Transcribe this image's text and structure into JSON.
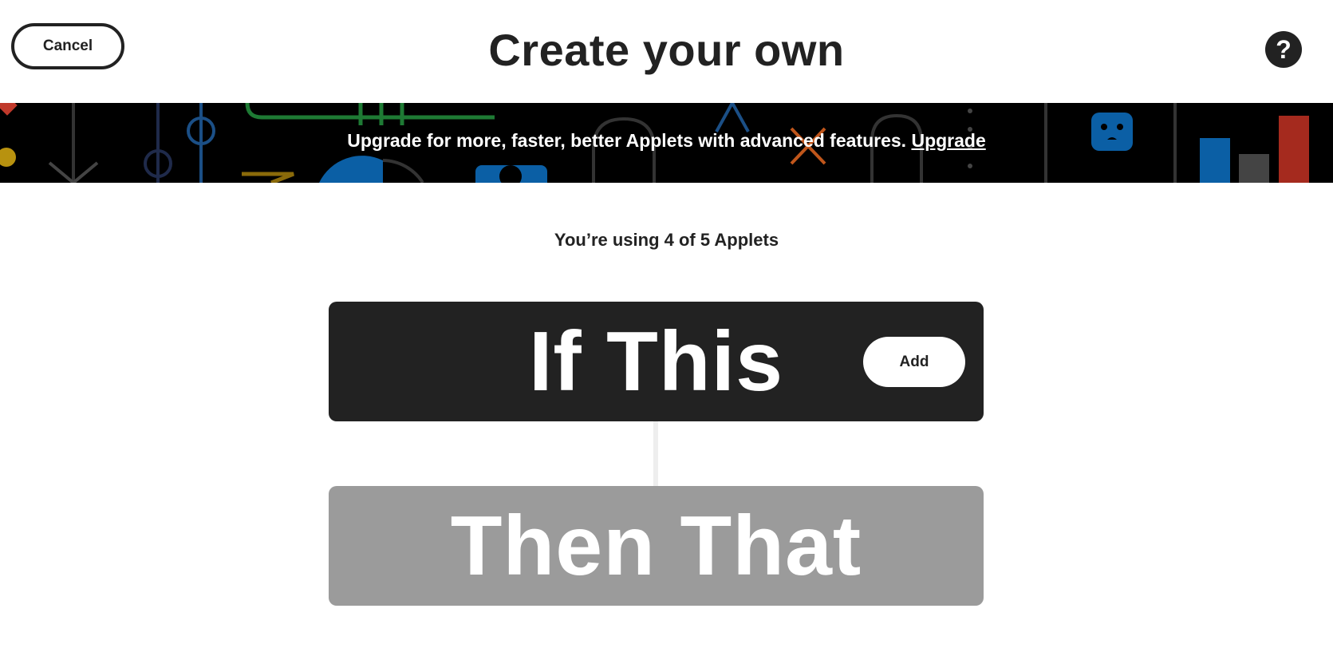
{
  "header": {
    "cancel_label": "Cancel",
    "title": "Create your own",
    "help_icon": "question-mark-icon",
    "help_glyph": "?"
  },
  "banner": {
    "message": "Upgrade for more, faster, better Applets with advanced features.",
    "link_label": "Upgrade"
  },
  "usage": {
    "text": "You’re using 4 of 5 Applets"
  },
  "if_block": {
    "title": "If This",
    "add_label": "Add"
  },
  "then_block": {
    "title": "Then That"
  },
  "colors": {
    "text": "#222222",
    "if_block_bg": "#222222",
    "then_block_bg": "#9b9b9b",
    "banner_bg": "#000000",
    "connector": "#eeeeee"
  }
}
